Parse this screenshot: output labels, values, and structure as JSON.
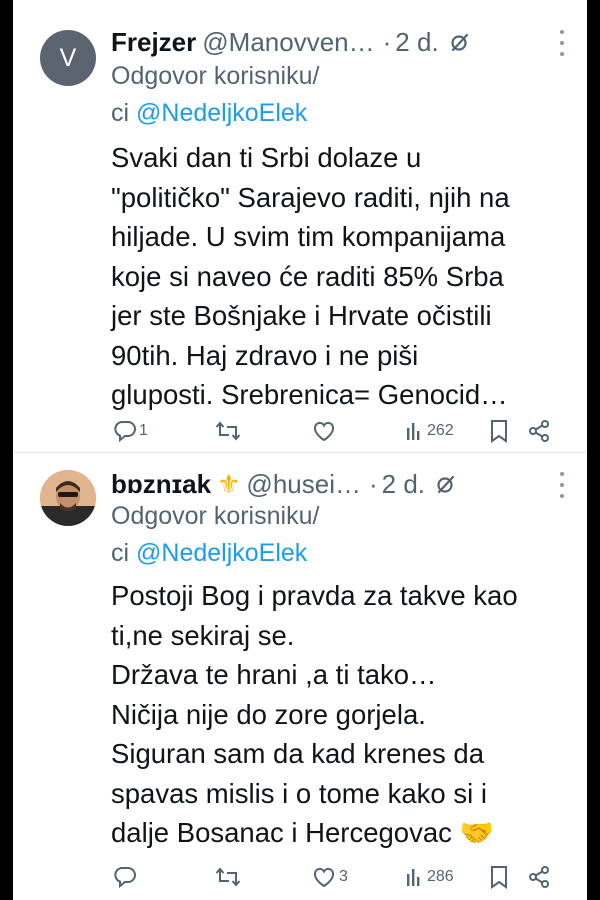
{
  "tweets": [
    {
      "avatar_letter": "V",
      "name": "Frejzer",
      "handle": "@Manovven…",
      "separator": "·",
      "time": "2 d.",
      "reply_prefix": "Odgovor korisniku/",
      "reply_prefix2": "ci",
      "reply_to": "@NedeljkoElek",
      "text": "Svaki dan ti Srbi dolaze u\n\"političko\" Sarajevo raditi, njih na\nhiljade. U svim tim kompanijama\nkoje si naveo će raditi 85% Srba\njer ste Bošnjake i Hrvate očistili\n90tih. Haj zdravo i ne piši\ngluposti. Srebrenica= Genocid…",
      "replies": "1",
      "reposts": "",
      "likes": "",
      "views": "262"
    },
    {
      "avatar_letter": "",
      "name": "bɒznɪak",
      "name_emoji": "⚜",
      "handle": "@husei…",
      "separator": "·",
      "time": "2 d.",
      "reply_prefix": "Odgovor korisniku/",
      "reply_prefix2": "ci",
      "reply_to": "@NedeljkoElek",
      "text": "Postoji Bog i pravda za takve kao\nti,ne sekiraj se.\nDržava te hrani ,a ti tako…\nNičija nije do zore gorjela.\nSiguran sam da kad krenes da\nspavas mislis i o tome kako si i\ndalje Bosanac i Hercegovac 🤝",
      "replies": "",
      "reposts": "",
      "likes": "3",
      "views": "286"
    }
  ],
  "colors": {
    "text": "#0f1419",
    "secondary": "#536471",
    "link": "#1d9bf0",
    "avatar_bg": "#5b6470"
  },
  "icons": [
    "grok-icon",
    "more-icon",
    "reply-icon",
    "repost-icon",
    "like-icon",
    "views-icon",
    "bookmark-icon",
    "share-icon",
    "fleur-de-lis-icon"
  ]
}
